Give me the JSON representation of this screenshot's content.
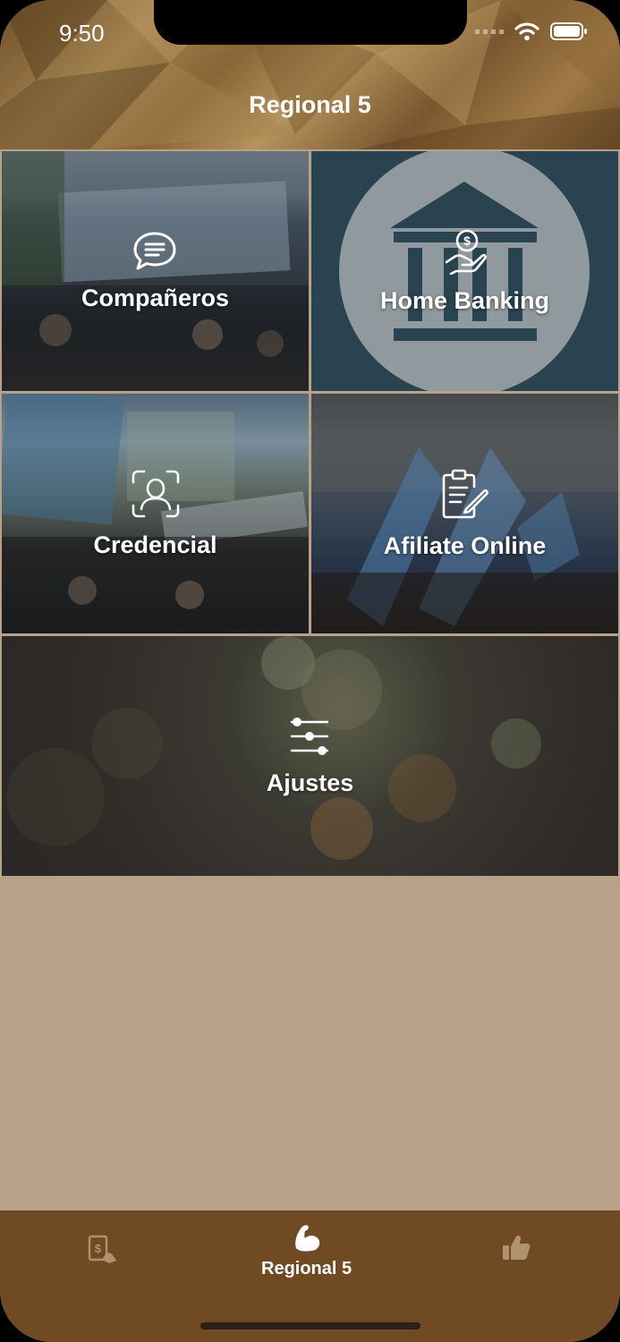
{
  "status_bar": {
    "time": "9:50"
  },
  "header": {
    "title": "Regional 5"
  },
  "tiles": [
    {
      "label": "Compañeros",
      "icon": "chat-bubble-icon"
    },
    {
      "label": "Home Banking",
      "icon": "money-hand-icon"
    },
    {
      "label": "Credencial",
      "icon": "face-scan-icon"
    },
    {
      "label": "Afiliate Online",
      "icon": "clipboard-edit-icon"
    },
    {
      "label": "Ajustes",
      "icon": "sliders-icon"
    }
  ],
  "tab_bar": {
    "items": [
      {
        "label": "",
        "icon": "payment-hand-icon"
      },
      {
        "label": "Regional 5",
        "icon": "muscle-arm-icon",
        "active": true
      },
      {
        "label": "",
        "icon": "thumbs-up-icon"
      }
    ]
  },
  "colors": {
    "background": "#b7a189",
    "tab_bar": "#6f4a22",
    "bank_tile": "#2f4d5d"
  }
}
